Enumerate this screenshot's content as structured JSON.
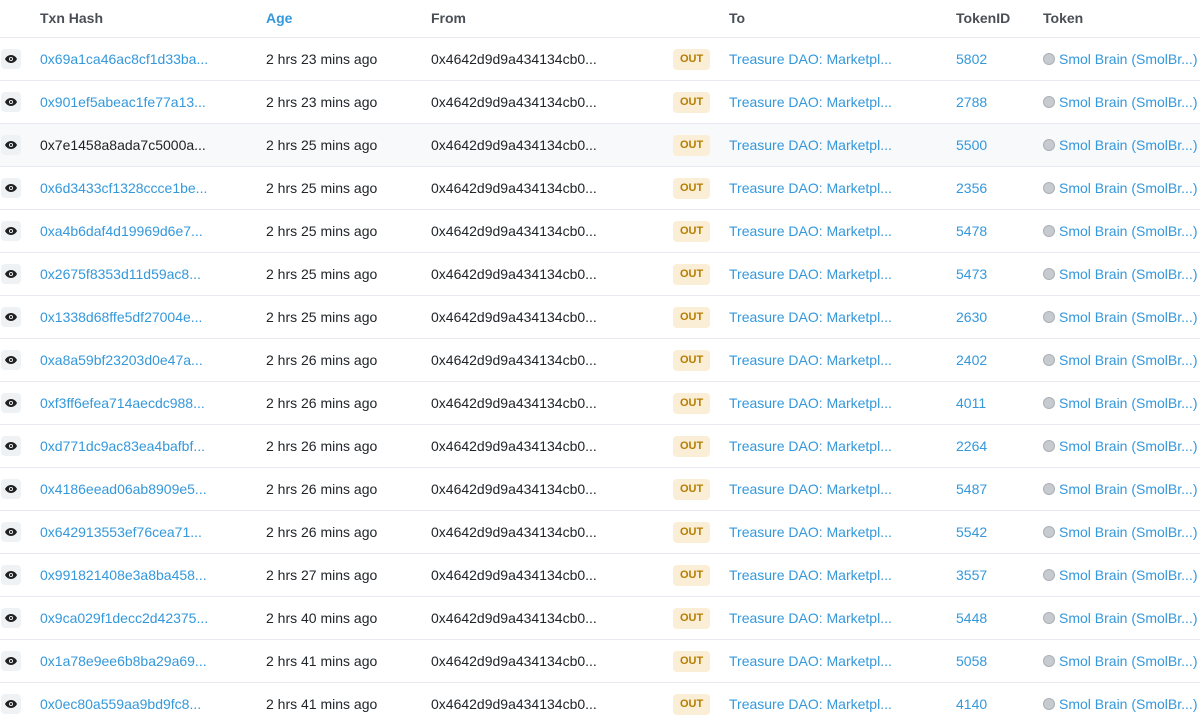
{
  "headers": {
    "txn_hash": "Txn Hash",
    "age": "Age",
    "from": "From",
    "to": "To",
    "token_id": "TokenID",
    "token": "Token"
  },
  "colors": {
    "link": "#3498db",
    "badge_bg": "#fbeed7",
    "badge_text": "#b47d00",
    "header_sorted": "#3498db"
  },
  "icons": {
    "row_preview": "eye-icon",
    "token_logo": "token-logo-icon"
  },
  "rows": [
    {
      "hash": "0x69a1ca46ac8cf1d33ba...",
      "age": "2 hrs 23 mins ago",
      "from": "0x4642d9d9a434134cb0...",
      "direction": "OUT",
      "to": "Treasure DAO: Marketpl...",
      "token_id": "5802",
      "token": "Smol Brain (SmolBr...)"
    },
    {
      "hash": "0x901ef5abeac1fe77a13...",
      "age": "2 hrs 23 mins ago",
      "from": "0x4642d9d9a434134cb0...",
      "direction": "OUT",
      "to": "Treasure DAO: Marketpl...",
      "token_id": "2788",
      "token": "Smol Brain (SmolBr...)"
    },
    {
      "hash": "0x7e1458a8ada7c5000a...",
      "age": "2 hrs 25 mins ago",
      "from": "0x4642d9d9a434134cb0...",
      "direction": "OUT",
      "to": "Treasure DAO: Marketpl...",
      "token_id": "5500",
      "token": "Smol Brain (SmolBr...)"
    },
    {
      "hash": "0x6d3433cf1328ccce1be...",
      "age": "2 hrs 25 mins ago",
      "from": "0x4642d9d9a434134cb0...",
      "direction": "OUT",
      "to": "Treasure DAO: Marketpl...",
      "token_id": "2356",
      "token": "Smol Brain (SmolBr...)"
    },
    {
      "hash": "0xa4b6daf4d19969d6e7...",
      "age": "2 hrs 25 mins ago",
      "from": "0x4642d9d9a434134cb0...",
      "direction": "OUT",
      "to": "Treasure DAO: Marketpl...",
      "token_id": "5478",
      "token": "Smol Brain (SmolBr...)"
    },
    {
      "hash": "0x2675f8353d11d59ac8...",
      "age": "2 hrs 25 mins ago",
      "from": "0x4642d9d9a434134cb0...",
      "direction": "OUT",
      "to": "Treasure DAO: Marketpl...",
      "token_id": "5473",
      "token": "Smol Brain (SmolBr...)"
    },
    {
      "hash": "0x1338d68ffe5df27004e...",
      "age": "2 hrs 25 mins ago",
      "from": "0x4642d9d9a434134cb0...",
      "direction": "OUT",
      "to": "Treasure DAO: Marketpl...",
      "token_id": "2630",
      "token": "Smol Brain (SmolBr...)"
    },
    {
      "hash": "0xa8a59bf23203d0e47a...",
      "age": "2 hrs 26 mins ago",
      "from": "0x4642d9d9a434134cb0...",
      "direction": "OUT",
      "to": "Treasure DAO: Marketpl...",
      "token_id": "2402",
      "token": "Smol Brain (SmolBr...)"
    },
    {
      "hash": "0xf3ff6efea714aecdc988...",
      "age": "2 hrs 26 mins ago",
      "from": "0x4642d9d9a434134cb0...",
      "direction": "OUT",
      "to": "Treasure DAO: Marketpl...",
      "token_id": "4011",
      "token": "Smol Brain (SmolBr...)"
    },
    {
      "hash": "0xd771dc9ac83ea4bafbf...",
      "age": "2 hrs 26 mins ago",
      "from": "0x4642d9d9a434134cb0...",
      "direction": "OUT",
      "to": "Treasure DAO: Marketpl...",
      "token_id": "2264",
      "token": "Smol Brain (SmolBr...)"
    },
    {
      "hash": "0x4186eead06ab8909e5...",
      "age": "2 hrs 26 mins ago",
      "from": "0x4642d9d9a434134cb0...",
      "direction": "OUT",
      "to": "Treasure DAO: Marketpl...",
      "token_id": "5487",
      "token": "Smol Brain (SmolBr...)"
    },
    {
      "hash": "0x642913553ef76cea71...",
      "age": "2 hrs 26 mins ago",
      "from": "0x4642d9d9a434134cb0...",
      "direction": "OUT",
      "to": "Treasure DAO: Marketpl...",
      "token_id": "5542",
      "token": "Smol Brain (SmolBr...)"
    },
    {
      "hash": "0x991821408e3a8ba458...",
      "age": "2 hrs 27 mins ago",
      "from": "0x4642d9d9a434134cb0...",
      "direction": "OUT",
      "to": "Treasure DAO: Marketpl...",
      "token_id": "3557",
      "token": "Smol Brain (SmolBr...)"
    },
    {
      "hash": "0x9ca029f1decc2d42375...",
      "age": "2 hrs 40 mins ago",
      "from": "0x4642d9d9a434134cb0...",
      "direction": "OUT",
      "to": "Treasure DAO: Marketpl...",
      "token_id": "5448",
      "token": "Smol Brain (SmolBr...)"
    },
    {
      "hash": "0x1a78e9ee6b8ba29a69...",
      "age": "2 hrs 41 mins ago",
      "from": "0x4642d9d9a434134cb0...",
      "direction": "OUT",
      "to": "Treasure DAO: Marketpl...",
      "token_id": "5058",
      "token": "Smol Brain (SmolBr...)"
    },
    {
      "hash": "0x0ec80a559aa9bd9fc8...",
      "age": "2 hrs 41 mins ago",
      "from": "0x4642d9d9a434134cb0...",
      "direction": "OUT",
      "to": "Treasure DAO: Marketpl...",
      "token_id": "4140",
      "token": "Smol Brain (SmolBr...)"
    }
  ]
}
